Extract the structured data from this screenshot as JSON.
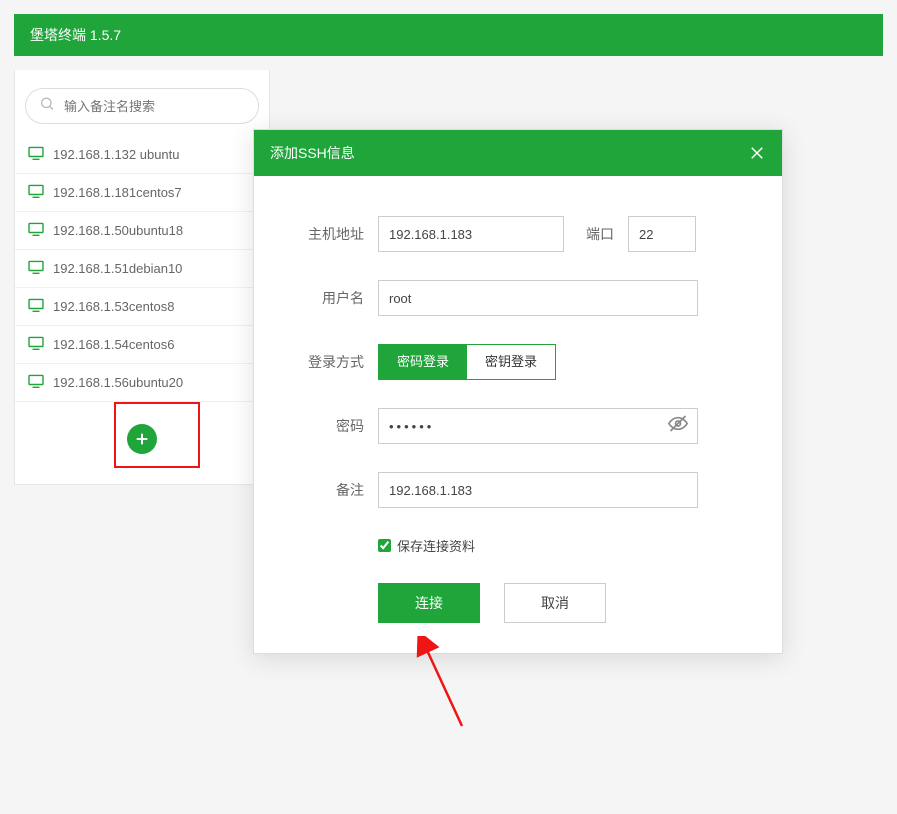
{
  "header": {
    "title": "堡塔终端 1.5.7"
  },
  "sidebar": {
    "search_placeholder": "输入备注名搜索",
    "hosts": [
      {
        "label": "192.168.1.132 ubuntu"
      },
      {
        "label": "192.168.1.181centos7"
      },
      {
        "label": "192.168.1.50ubuntu18"
      },
      {
        "label": "192.168.1.51debian10"
      },
      {
        "label": "192.168.1.53centos8"
      },
      {
        "label": "192.168.1.54centos6"
      },
      {
        "label": "192.168.1.56ubuntu20"
      }
    ]
  },
  "modal": {
    "title": "添加SSH信息",
    "labels": {
      "host": "主机地址",
      "port": "端口",
      "username": "用户名",
      "login_type": "登录方式",
      "password": "密码",
      "remark": "备注",
      "save_conn": "保存连接资料"
    },
    "values": {
      "host": "192.168.1.183",
      "port": "22",
      "username": "root",
      "password": "••••••",
      "remark": "192.168.1.183",
      "save_checked": true
    },
    "login_types": {
      "password": "密码登录",
      "key": "密钥登录"
    },
    "buttons": {
      "connect": "连接",
      "cancel": "取消"
    }
  },
  "colors": {
    "primary": "#20a53a",
    "highlight": "#f01414"
  }
}
